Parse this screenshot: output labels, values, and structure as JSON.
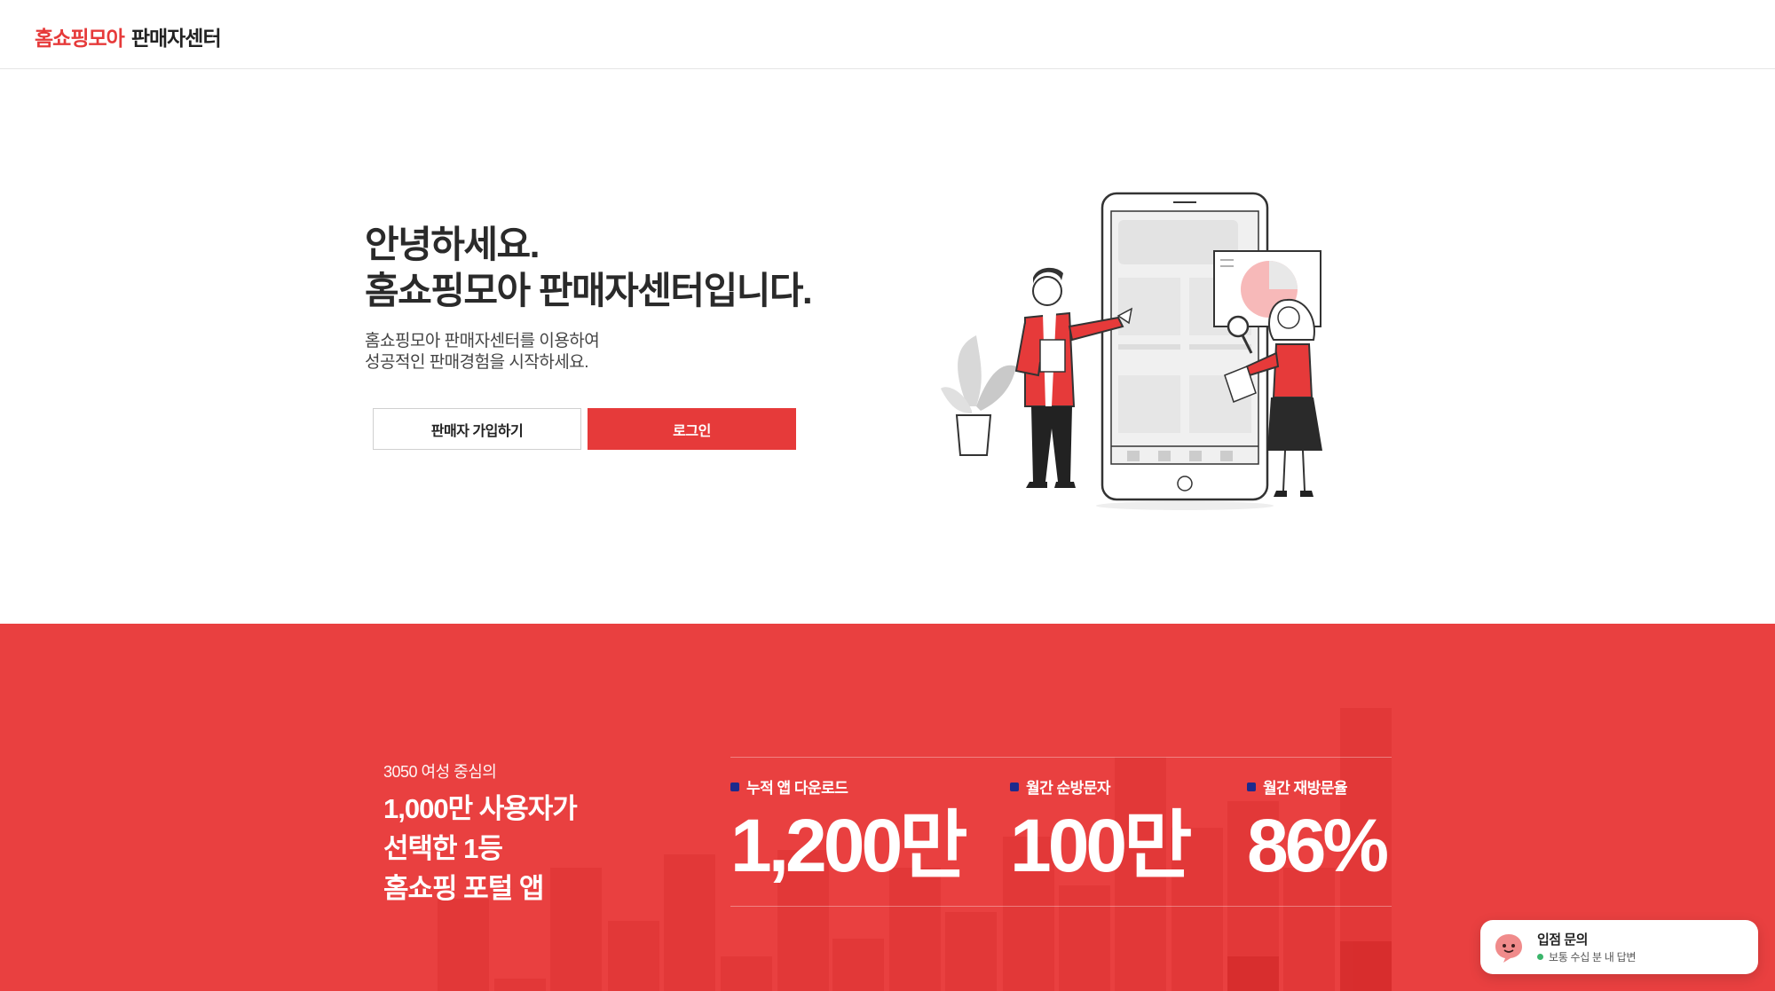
{
  "header": {
    "brand": "홈쇼핑모아",
    "subtitle": "판매자센터"
  },
  "hero": {
    "title_line1": "안녕하세요.",
    "title_line2": "홈쇼핑모아 판매자센터입니다.",
    "desc_line1": "홈쇼핑모아 판매자센터를 이용하여",
    "desc_line2": "성공적인 판매경험을 시작하세요.",
    "signup_label": "판매자 가입하기",
    "login_label": "로그인"
  },
  "stats": {
    "kicker": "3050 여성 중심의",
    "headline_line1": "1,000만 사용자가",
    "headline_line2": "선택한 1등",
    "headline_line3": "홈쇼핑 포털 앱",
    "items": [
      {
        "label": "누적 앱 다운로드",
        "value": "1,200만"
      },
      {
        "label": "월간 순방문자",
        "value": "100만"
      },
      {
        "label": "월간 재방문율",
        "value": "86%"
      }
    ]
  },
  "chat": {
    "title": "입점 문의",
    "status": "보통 수십 분 내 답변"
  },
  "colors": {
    "accent": "#e63a3a",
    "band": "#e94040",
    "stat_marker": "#1c2a8c",
    "online": "#3bb56b"
  },
  "icons": {
    "chat_avatar": "chat-bubble-face-icon",
    "stat_marker": "square-bullet-icon"
  }
}
